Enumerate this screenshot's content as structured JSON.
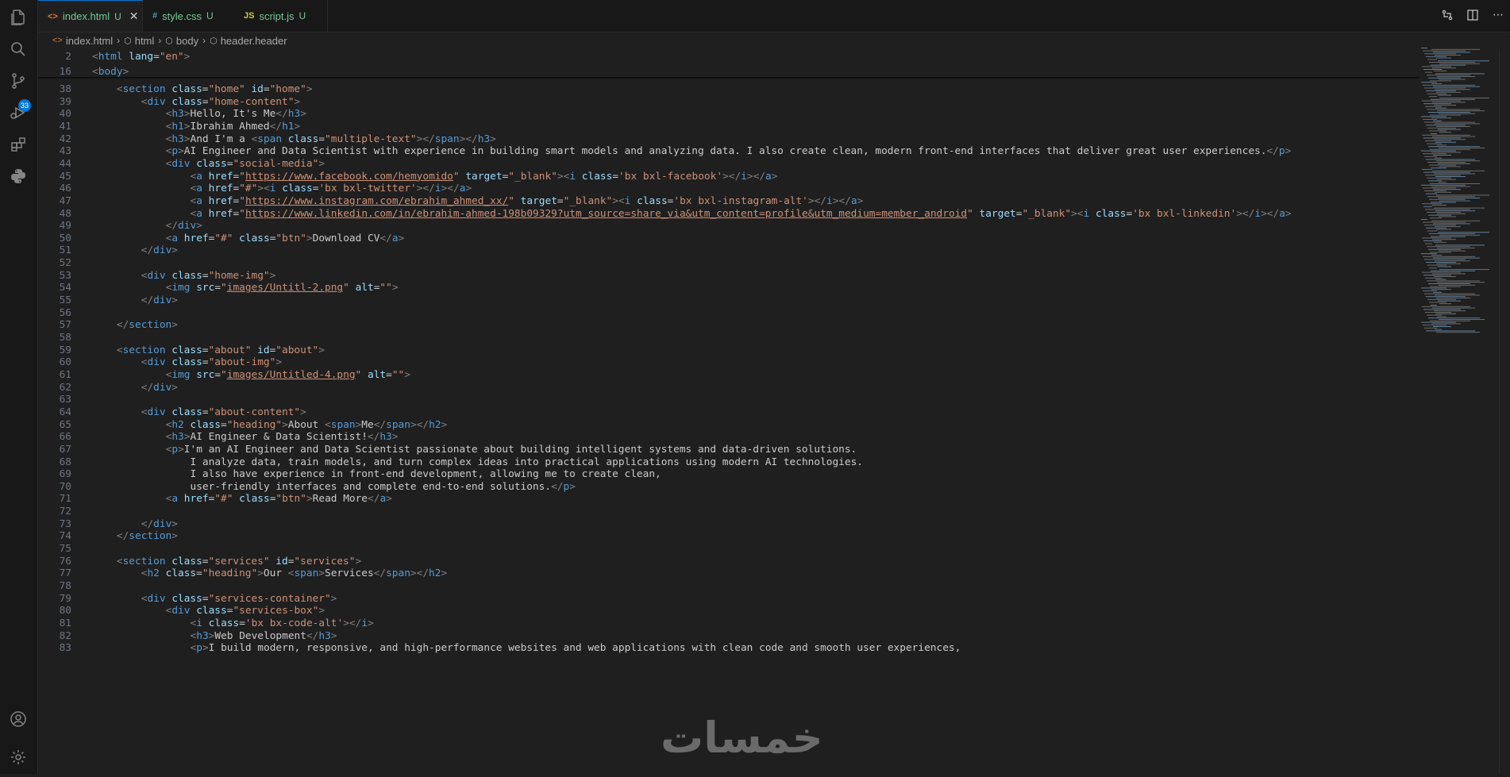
{
  "activity_bar": {
    "items": [
      "explorer-icon",
      "search-icon",
      "source-control-icon",
      "run-debug-icon",
      "extensions-icon",
      "python-icon"
    ],
    "source_control_badge": "33",
    "bottom": [
      "account-icon",
      "settings-icon"
    ]
  },
  "tabs": [
    {
      "icon": "<>",
      "name": "index.html",
      "status": "U",
      "active": true
    },
    {
      "icon": "#",
      "name": "style.css",
      "status": "U",
      "active": false
    },
    {
      "icon": "JS",
      "name": "script.js",
      "status": "U",
      "active": false
    }
  ],
  "breadcrumb": [
    "index.html",
    "html",
    "body",
    "header.header"
  ],
  "colors": {
    "accent": "#0078d4",
    "tag": "#569cd6",
    "attr": "#9cdcfe",
    "string": "#ce9178",
    "bracket": "#808080",
    "untracked": "#73c991"
  },
  "lines": [
    {
      "n": "2",
      "i": 0,
      "code": "<html lang=\"en\">"
    },
    {
      "n": "16",
      "i": 0,
      "code": "<body>"
    },
    {
      "n": "38",
      "i": 1,
      "code": "<section class=\"home\" id=\"home\">"
    },
    {
      "n": "39",
      "i": 2,
      "code": "<div class=\"home-content\">"
    },
    {
      "n": "40",
      "i": 3,
      "code": "<h3>Hello, It's Me</h3>"
    },
    {
      "n": "41",
      "i": 3,
      "code": "<h1>Ibrahim Ahmed</h1>"
    },
    {
      "n": "42",
      "i": 3,
      "code": "<h3>And I'm a <span class=\"multiple-text\"></span></h3>"
    },
    {
      "n": "43",
      "i": 3,
      "code": "<p>AI Engineer and Data Scientist with experience in building smart models and analyzing data. I also create clean, modern front-end interfaces that deliver great user experiences.</p>"
    },
    {
      "n": "44",
      "i": 3,
      "code": "<div class=\"social-media\">"
    },
    {
      "n": "45",
      "i": 4,
      "code": "<a href=\"https://www.facebook.com/hemyomido\" target=\"_blank\"><i class='bx bxl-facebook'></i></a>"
    },
    {
      "n": "46",
      "i": 4,
      "code": "<a href=\"#\"><i class='bx bxl-twitter'></i></a>"
    },
    {
      "n": "47",
      "i": 4,
      "code": "<a href=\"https://www.instagram.com/ebrahim_ahmed_xx/\" target=\"_blank\"><i class='bx bxl-instagram-alt'></i></a>"
    },
    {
      "n": "48",
      "i": 4,
      "code": "<a href=\"https://www.linkedin.com/in/ebrahim-ahmed-198b09329?utm_source=share_via&utm_content=profile&utm_medium=member_android\" target=\"_blank\"><i class='bx bxl-linkedin'></i></a>"
    },
    {
      "n": "49",
      "i": 3,
      "code": "</div>"
    },
    {
      "n": "50",
      "i": 3,
      "code": "<a href=\"#\" class=\"btn\">Download CV</a>"
    },
    {
      "n": "51",
      "i": 2,
      "code": "</div>"
    },
    {
      "n": "52",
      "i": 0,
      "code": ""
    },
    {
      "n": "53",
      "i": 2,
      "code": "<div class=\"home-img\">"
    },
    {
      "n": "54",
      "i": 3,
      "code": "<img src=\"images/Untitl-2.png\" alt=\"\">"
    },
    {
      "n": "55",
      "i": 2,
      "code": "</div>"
    },
    {
      "n": "56",
      "i": 0,
      "code": ""
    },
    {
      "n": "57",
      "i": 1,
      "code": "</section>"
    },
    {
      "n": "58",
      "i": 0,
      "code": ""
    },
    {
      "n": "59",
      "i": 1,
      "code": "<section class=\"about\" id=\"about\">"
    },
    {
      "n": "60",
      "i": 2,
      "code": "<div class=\"about-img\">"
    },
    {
      "n": "61",
      "i": 3,
      "code": "<img src=\"images/Untitled-4.png\" alt=\"\">"
    },
    {
      "n": "62",
      "i": 2,
      "code": "</div>"
    },
    {
      "n": "63",
      "i": 0,
      "code": ""
    },
    {
      "n": "64",
      "i": 2,
      "code": "<div class=\"about-content\">"
    },
    {
      "n": "65",
      "i": 3,
      "code": "<h2 class=\"heading\">About <span>Me</span></h2>"
    },
    {
      "n": "66",
      "i": 3,
      "code": "<h3>AI Engineer & Data Scientist!</h3>"
    },
    {
      "n": "67",
      "i": 3,
      "code": "<p>I'm an AI Engineer and Data Scientist passionate about building intelligent systems and data-driven solutions."
    },
    {
      "n": "68",
      "i": 4,
      "code": "I analyze data, train models, and turn complex ideas into practical applications using modern AI technologies."
    },
    {
      "n": "69",
      "i": 4,
      "code": "I also have experience in front-end development, allowing me to create clean,"
    },
    {
      "n": "70",
      "i": 4,
      "code": "user-friendly interfaces and complete end-to-end solutions.</p>"
    },
    {
      "n": "71",
      "i": 3,
      "code": "<a href=\"#\" class=\"btn\">Read More</a>"
    },
    {
      "n": "72",
      "i": 0,
      "code": ""
    },
    {
      "n": "73",
      "i": 2,
      "code": "</div>"
    },
    {
      "n": "74",
      "i": 1,
      "code": "</section>"
    },
    {
      "n": "75",
      "i": 0,
      "code": ""
    },
    {
      "n": "76",
      "i": 1,
      "code": "<section class=\"services\" id=\"services\">"
    },
    {
      "n": "77",
      "i": 2,
      "code": "<h2 class=\"heading\">Our <span>Services</span></h2>"
    },
    {
      "n": "78",
      "i": 0,
      "code": ""
    },
    {
      "n": "79",
      "i": 2,
      "code": "<div class=\"services-container\">"
    },
    {
      "n": "80",
      "i": 3,
      "code": "<div class=\"services-box\">"
    },
    {
      "n": "81",
      "i": 4,
      "code": "<i class='bx bx-code-alt'></i>"
    },
    {
      "n": "82",
      "i": 4,
      "code": "<h3>Web Development</h3>"
    },
    {
      "n": "83",
      "i": 4,
      "code": "<p>I build modern, responsive, and high-performance websites and web applications with clean code and smooth user experiences,"
    }
  ],
  "watermark": "خمسات"
}
